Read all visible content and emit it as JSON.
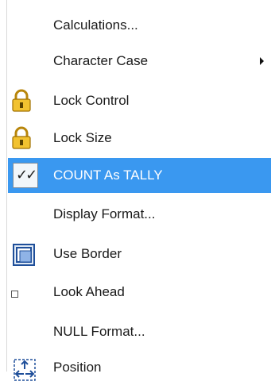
{
  "menu": {
    "items": [
      {
        "label": "Calculations...",
        "icon": null
      },
      {
        "label": "Character Case",
        "icon": null,
        "submenu": true
      },
      {
        "label": "Lock Control",
        "icon": "lock-icon"
      },
      {
        "label": "Lock Size",
        "icon": "lock-icon"
      },
      {
        "label": "COUNT As TALLY",
        "icon": "checkmark-icon",
        "selected": true
      },
      {
        "label": "Display Format...",
        "icon": null
      },
      {
        "label": "Use Border",
        "icon": "border-icon"
      },
      {
        "label": "Look Ahead",
        "icon": "checkbox-icon"
      },
      {
        "label": "NULL Format...",
        "icon": null
      },
      {
        "label": "Position",
        "icon": "position-icon"
      }
    ],
    "colors": {
      "highlight": "#3a98f0",
      "highlight_text": "#ffffff",
      "text": "#1a1a1a"
    }
  }
}
